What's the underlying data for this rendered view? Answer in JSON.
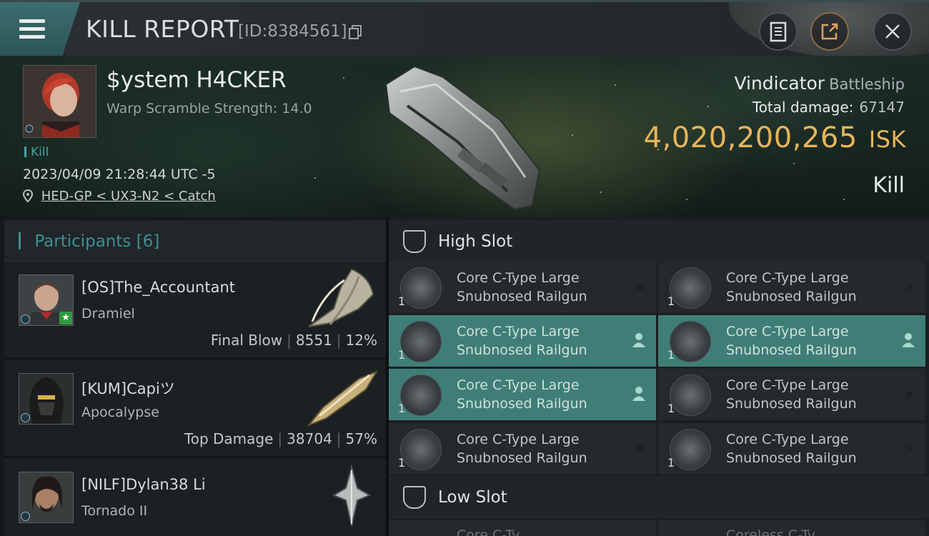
{
  "header": {
    "title": "KILL REPORT",
    "report_id": "[ID:8384561]"
  },
  "victim": {
    "name": "$ystem H4CKER",
    "subtitle": "Warp Scramble Strength: 14.0",
    "tag": "Kill",
    "timestamp": "2023/04/09 21:28:44 UTC -5",
    "location": "HED-GP < UX3-N2 < Catch"
  },
  "ship": {
    "name": "Vindicator",
    "class": "Battleship",
    "total_damage_label": "Total damage:",
    "total_damage": "67147",
    "isk_value": "4,020,200,265",
    "isk_unit": "ISK",
    "result": "Kill"
  },
  "participants": {
    "label": "Participants",
    "count": "[6]",
    "rows": [
      {
        "name": "[OS]The_Accountant",
        "ship": "Dramiel",
        "role": "Final Blow",
        "damage": "8551",
        "percent": "12%"
      },
      {
        "name": "[KUM]Capiツ",
        "ship": "Apocalypse",
        "role": "Top Damage",
        "damage": "38704",
        "percent": "57%"
      },
      {
        "name": "[NILF]Dylan38 Li",
        "ship": "Tornado II",
        "role": "",
        "damage": "",
        "percent": ""
      }
    ]
  },
  "fitting": {
    "high_slot_label": "High Slot",
    "low_slot_label": "Low Slot",
    "modules": [
      {
        "name_line1": "Core C-Type Large",
        "name_line2": "Snubnosed Railgun",
        "qty": "1"
      },
      {
        "name_line1": "Core C-Type Large",
        "name_line2": "Snubnosed Railgun",
        "qty": "1"
      },
      {
        "name_line1": "Core C-Type Large",
        "name_line2": "Snubnosed Railgun",
        "qty": "1"
      },
      {
        "name_line1": "Core C-Type Large",
        "name_line2": "Snubnosed Railgun",
        "qty": "1"
      },
      {
        "name_line1": "Core C-Type Large",
        "name_line2": "Snubnosed Railgun",
        "qty": "1"
      },
      {
        "name_line1": "Core C-Type Large",
        "name_line2": "Snubnosed Railgun",
        "qty": "1"
      },
      {
        "name_line1": "Core C-Type Large",
        "name_line2": "Snubnosed Railgun",
        "qty": "1"
      },
      {
        "name_line1": "Core C-Type Large",
        "name_line2": "Snubnosed Railgun",
        "qty": "1"
      }
    ],
    "low_partial_line1": "Core C-Ty",
    "low_partial_line2": "Coreless C-Ty"
  },
  "colors": {
    "accent_teal": "#3f8f93",
    "isk_gold": "#e8b45a",
    "highlight_row": "#3f7e77"
  }
}
